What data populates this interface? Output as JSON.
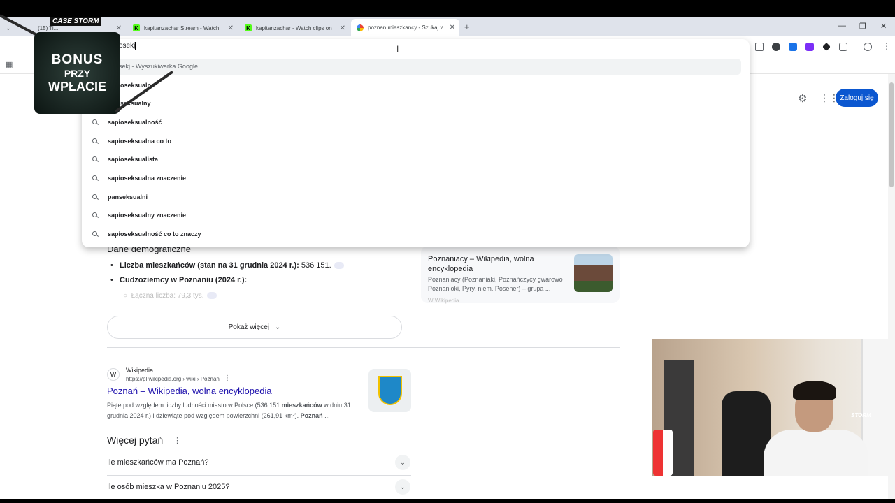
{
  "browser": {
    "tabs": [
      {
        "title": "(15) Ti...",
        "active": false
      },
      {
        "title": "kapitanzachar Stream - Watch Live",
        "active": false
      },
      {
        "title": "kapitanzachar - Watch clips on Kick",
        "active": false
      },
      {
        "title": "poznan mieszkancy - Szukaj w Google",
        "active": true
      }
    ],
    "new_tab_glyph": "+",
    "close_glyph": "✕",
    "window_controls": [
      "—",
      "❐",
      "✕"
    ],
    "omnibox": {
      "value": "osekj",
      "suggestions_first": "osekj - Wyszukiwarka Google",
      "suggestions": [
        "oseksualna",
        "seksualny",
        "sapioseksualność",
        "sapioseksualna co to",
        "sapioseksualista",
        "sapioseksualna znaczenie",
        "panseksualni",
        "sapioseksualny znaczenie",
        "sapioseksualność co to znaczy"
      ]
    }
  },
  "google": {
    "login_label": "Zaloguj się",
    "settings_glyph": "⚙",
    "apps_glyph": "⋮⋮⋮",
    "demographics": {
      "title": "Dane demograficzne",
      "b1_label": "Liczba mieszkańców (stan na 31 grudnia 2024 r.):",
      "b1_value": "536 151.",
      "b2_label": "Cudzoziemcy w Poznaniu (2024 r.):",
      "sub1": "Łączna liczba: 79,3 tys."
    },
    "show_more": "Pokaż więcej",
    "wiki_card": {
      "title": "Poznaniacy – Wikipedia, wolna encyklopedia",
      "desc": "Poznaniacy (Poznaniaki, Poznańczycy gwarowo Poznanioki, Pyry, niem. Posener) – grupa ...",
      "source": "W Wikipedia"
    },
    "result": {
      "site": "Wikipedia",
      "url": "https://pl.wikipedia.org › wiki › Poznań",
      "title": "Poznań – Wikipedia, wolna encyklopedia",
      "snippet_a": "Piąte pod względem liczby ludności miasto w Polsce (536 151 ",
      "snippet_b": "mieszkańców",
      "snippet_c": " w dniu 31 grudnia 2024 r.) i dziewiąte pod względem powierzchni (261,91 km²). ",
      "snippet_d": "Poznań",
      "snippet_e": " ..."
    },
    "paa": {
      "title": "Więcej pytań",
      "q1": "Ile mieszkańców ma Poznań?",
      "q2": "Ile osób mieszka w Poznaniu 2025?"
    }
  },
  "overlay": {
    "brand": "CASE STORM",
    "line1": "BONUS",
    "line2": "PRZY",
    "line3": "WPŁACIE"
  },
  "webcam": {
    "brand": "STORM"
  }
}
